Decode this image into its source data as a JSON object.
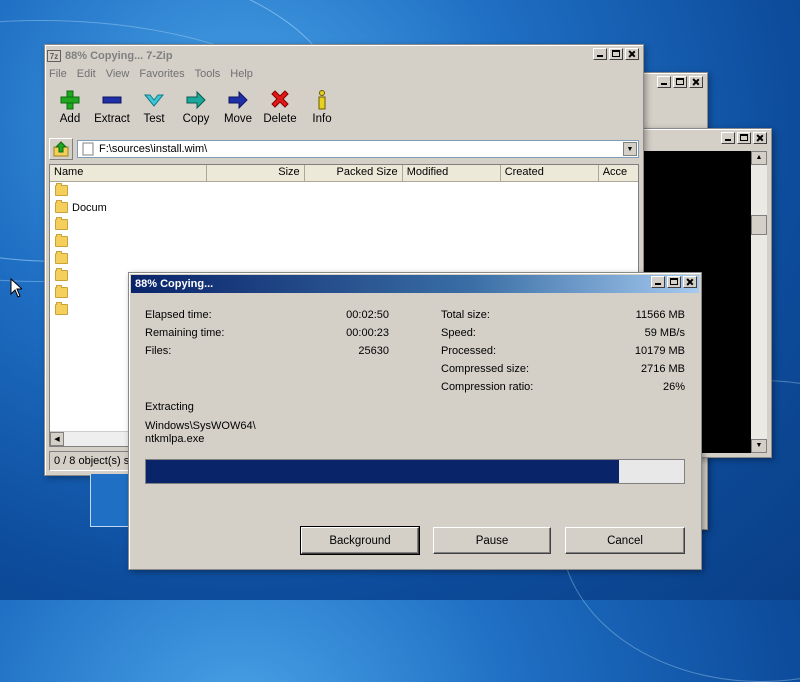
{
  "main_window": {
    "title": "88% Copying... 7-Zip",
    "menu": [
      "File",
      "Edit",
      "View",
      "Favorites",
      "Tools",
      "Help"
    ],
    "toolbar": [
      {
        "label": "Add",
        "icon": "plus-icon"
      },
      {
        "label": "Extract",
        "icon": "minus-icon"
      },
      {
        "label": "Test",
        "icon": "check-icon"
      },
      {
        "label": "Copy",
        "icon": "copy-arrow-icon"
      },
      {
        "label": "Move",
        "icon": "move-arrow-icon"
      },
      {
        "label": "Delete",
        "icon": "delete-x-icon"
      },
      {
        "label": "Info",
        "icon": "info-icon"
      }
    ],
    "address": "F:\\sources\\install.wim\\",
    "columns": [
      "Name",
      "Size",
      "Packed Size",
      "Modified",
      "Created",
      "Acce"
    ],
    "rows": [
      "",
      "Docum",
      "",
      "",
      "",
      "",
      "",
      ""
    ],
    "status": "0 / 8 object(s) se"
  },
  "progress_window": {
    "title": "88% Copying...",
    "elapsed_label": "Elapsed time:",
    "elapsed_value": "00:02:50",
    "remaining_label": "Remaining time:",
    "remaining_value": "00:00:23",
    "files_label": "Files:",
    "files_value": "25630",
    "total_size_label": "Total size:",
    "total_size_value": "11566 MB",
    "speed_label": "Speed:",
    "speed_value": "59 MB/s",
    "processed_label": "Processed:",
    "processed_value": "10179 MB",
    "compressed_label": "Compressed size:",
    "compressed_value": "2716 MB",
    "ratio_label": "Compression ratio:",
    "ratio_value": "26%",
    "extracting_label": "Extracting",
    "path_line1": "Windows\\SysWOW64\\",
    "path_line2": "ntkmlpa.exe",
    "progress_percent": 88,
    "buttons": {
      "background": "Background",
      "pause": "Pause",
      "cancel": "Cancel"
    }
  },
  "colors": {
    "accent": "#0a246a",
    "window_face": "#d4d0c8",
    "desktop": "#1f6fc4"
  }
}
